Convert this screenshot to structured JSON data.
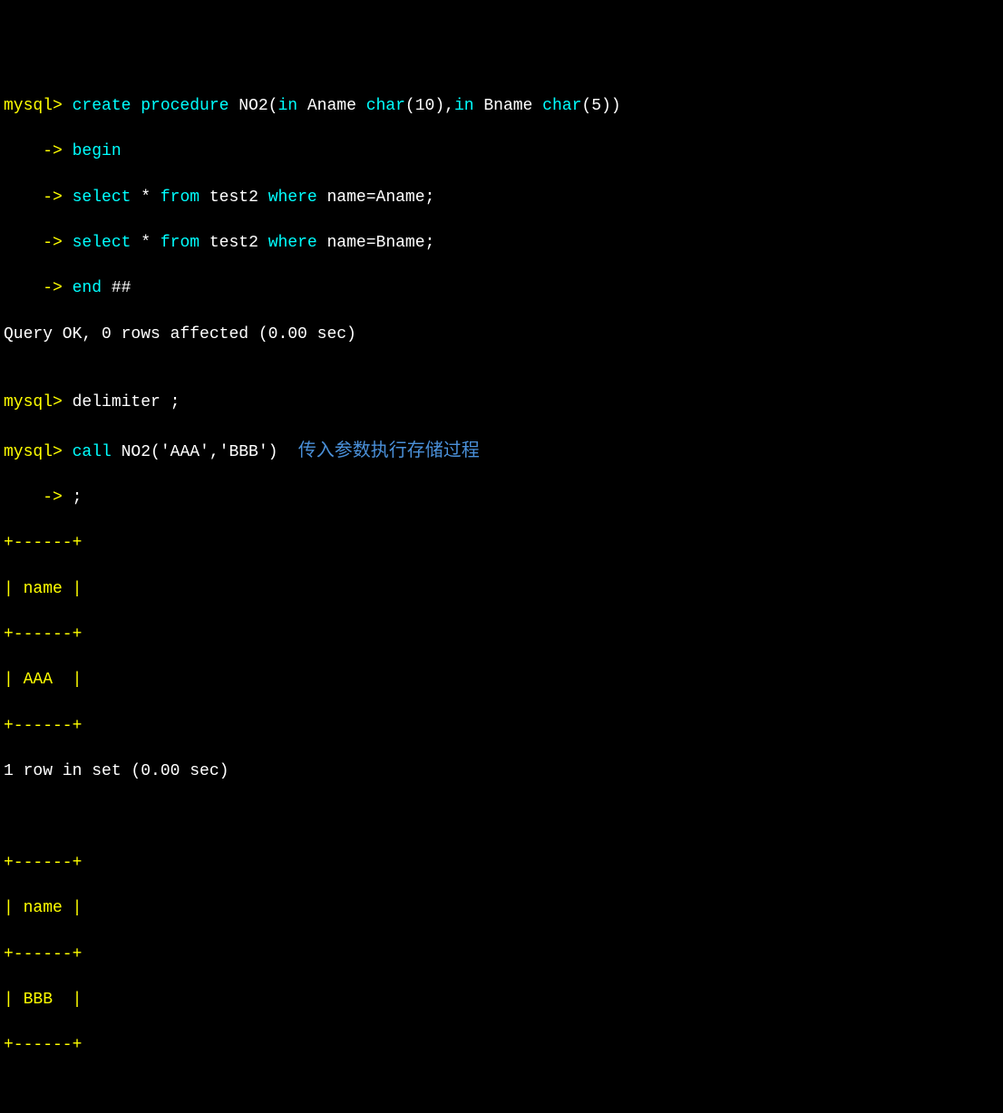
{
  "lines": {
    "line1_prompt": "mysql>",
    "line1_keyword1": " create procedure",
    "line1_text1": " NO2(",
    "line1_keyword2": "in",
    "line1_text2": " Aname ",
    "line1_keyword3": "char",
    "line1_text3": "(10),",
    "line1_keyword4": "in",
    "line1_text4": " Bname ",
    "line1_keyword5": "char",
    "line1_text5": "(5))",
    "line2_cont": "    ->",
    "line2_keyword": " begin",
    "line3_cont": "    ->",
    "line3_keyword1": " select",
    "line3_text1": " * ",
    "line3_keyword2": "from",
    "line3_text2": " test2 ",
    "line3_keyword3": "where",
    "line3_text3": " name=Aname;",
    "line4_cont": "    ->",
    "line4_keyword1": " select",
    "line4_text1": " * ",
    "line4_keyword2": "from",
    "line4_text2": " test2 ",
    "line4_keyword3": "where",
    "line4_text3": " name=Bname;",
    "line5_cont": "    ->",
    "line5_keyword": " end",
    "line5_text": " ##",
    "line6": "Query OK, 0 rows affected (0.00 sec)",
    "line7": "",
    "line8_prompt": "mysql>",
    "line8_text": " delimiter ;",
    "line9_prompt": "mysql>",
    "line9_keyword": " call",
    "line9_text": " NO2('AAA','BBB')",
    "line9_annotation": "    传入参数执行存储过程",
    "line10_cont": "    ->",
    "line10_text": " ;",
    "table1_border": "+------+",
    "table1_header": "| name |",
    "table1_row": "| AAA  |",
    "table1_result": "1 row in set (0.00 sec)",
    "table2_border": "+------+",
    "table2_header": "| name |",
    "table2_row": "| BBB  |"
  }
}
